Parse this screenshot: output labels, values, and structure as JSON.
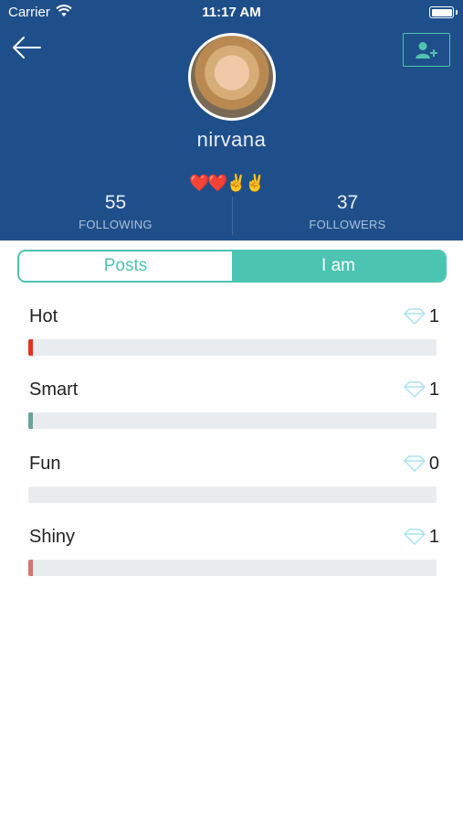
{
  "status_bar": {
    "carrier": "Carrier",
    "time": "11:17 AM"
  },
  "profile": {
    "username": "nirvana",
    "emojis": [
      "❤️",
      "❤️",
      "✌️",
      "✌️"
    ],
    "following_count": "55",
    "following_label": "FOLLOWING",
    "followers_count": "37",
    "followers_label": "FOLLOWERS"
  },
  "tabs": [
    {
      "label": "Posts",
      "active": false
    },
    {
      "label": "I am",
      "active": true
    }
  ],
  "traits": [
    {
      "name": "Hot",
      "count": "1",
      "fill_fraction": 0.011,
      "color": "#e1341e"
    },
    {
      "name": "Smart",
      "count": "1",
      "fill_fraction": 0.011,
      "color": "#6aa39c"
    },
    {
      "name": "Fun",
      "count": "0",
      "fill_fraction": 0,
      "color": "#e9ecef"
    },
    {
      "name": "Shiny",
      "count": "1",
      "fill_fraction": 0.011,
      "color": "#d57470"
    }
  ],
  "colors": {
    "header": "#1f4f8a",
    "accent": "#4cc4b2",
    "diamond": "#a9e3f2"
  }
}
